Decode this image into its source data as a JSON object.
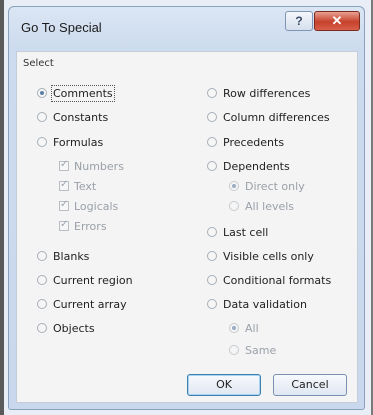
{
  "dialog": {
    "title": "Go To Special",
    "help_glyph": "?",
    "close_glyph": "✕",
    "group_label": "Select",
    "ok_label": "OK",
    "cancel_label": "Cancel"
  },
  "left": {
    "comments": "Comments",
    "constants": "Constants",
    "formulas": "Formulas",
    "numbers": "Numbers",
    "text": "Text",
    "logicals": "Logicals",
    "errors": "Errors",
    "blanks": "Blanks",
    "current_region": "Current region",
    "current_array": "Current array",
    "objects": "Objects"
  },
  "right": {
    "row_differences": "Row differences",
    "column_differences": "Column differences",
    "precedents": "Precedents",
    "dependents": "Dependents",
    "direct_only": "Direct only",
    "all_levels": "All levels",
    "last_cell": "Last cell",
    "visible_cells_only": "Visible cells only",
    "conditional_formats": "Conditional formats",
    "data_validation": "Data validation",
    "all": "All",
    "same": "Same"
  },
  "selected_option": "Comments"
}
